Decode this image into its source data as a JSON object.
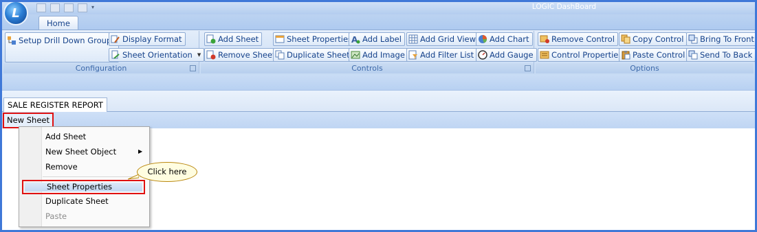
{
  "window": {
    "title": "LOGIC DashBoard",
    "app_button_letter": "L"
  },
  "ribbon_tabs": [
    {
      "label": "Home"
    }
  ],
  "groups": {
    "configuration": {
      "label": "Configuration",
      "buttons": {
        "setup_drill_down": "Setup Drill Down Groups",
        "display_format": "Display Format",
        "sheet_orientation": "Sheet Orientation"
      }
    },
    "controls": {
      "label": "Controls",
      "buttons": {
        "add_sheet": "Add Sheet",
        "remove_sheet": "Remove Sheet",
        "sheet_properties": "Sheet Properties",
        "duplicate_sheet": "Duplicate Sheet",
        "add_label": "Add Label",
        "add_image": "Add Image",
        "add_grid_view": "Add Grid View",
        "add_filter_list": "Add Filter List",
        "add_chart": "Add Chart",
        "add_gauge": "Add Gauge"
      }
    },
    "options": {
      "label": "Options",
      "buttons": {
        "remove_control": "Remove Control",
        "control_properties": "Control Properties",
        "copy_control": "Copy Control",
        "paste_control": "Paste Control",
        "bring_to_front": "Bring To Front",
        "send_to_back": "Send To Back"
      }
    }
  },
  "report_tab": {
    "label": "SALE REGISTER REPORT"
  },
  "sheet_tab": {
    "label": "New Sheet"
  },
  "context_menu": {
    "items": [
      {
        "label": "Add Sheet"
      },
      {
        "label": "New Sheet Object"
      },
      {
        "label": "Remove"
      },
      {
        "label": "Sheet Properties"
      },
      {
        "label": "Duplicate Sheet"
      },
      {
        "label": "Paste"
      }
    ]
  },
  "callout": {
    "text": "Click here"
  },
  "colors": {
    "frame": "#3f78d8",
    "highlight": "#e01010",
    "ribbon_text": "#15428b"
  }
}
